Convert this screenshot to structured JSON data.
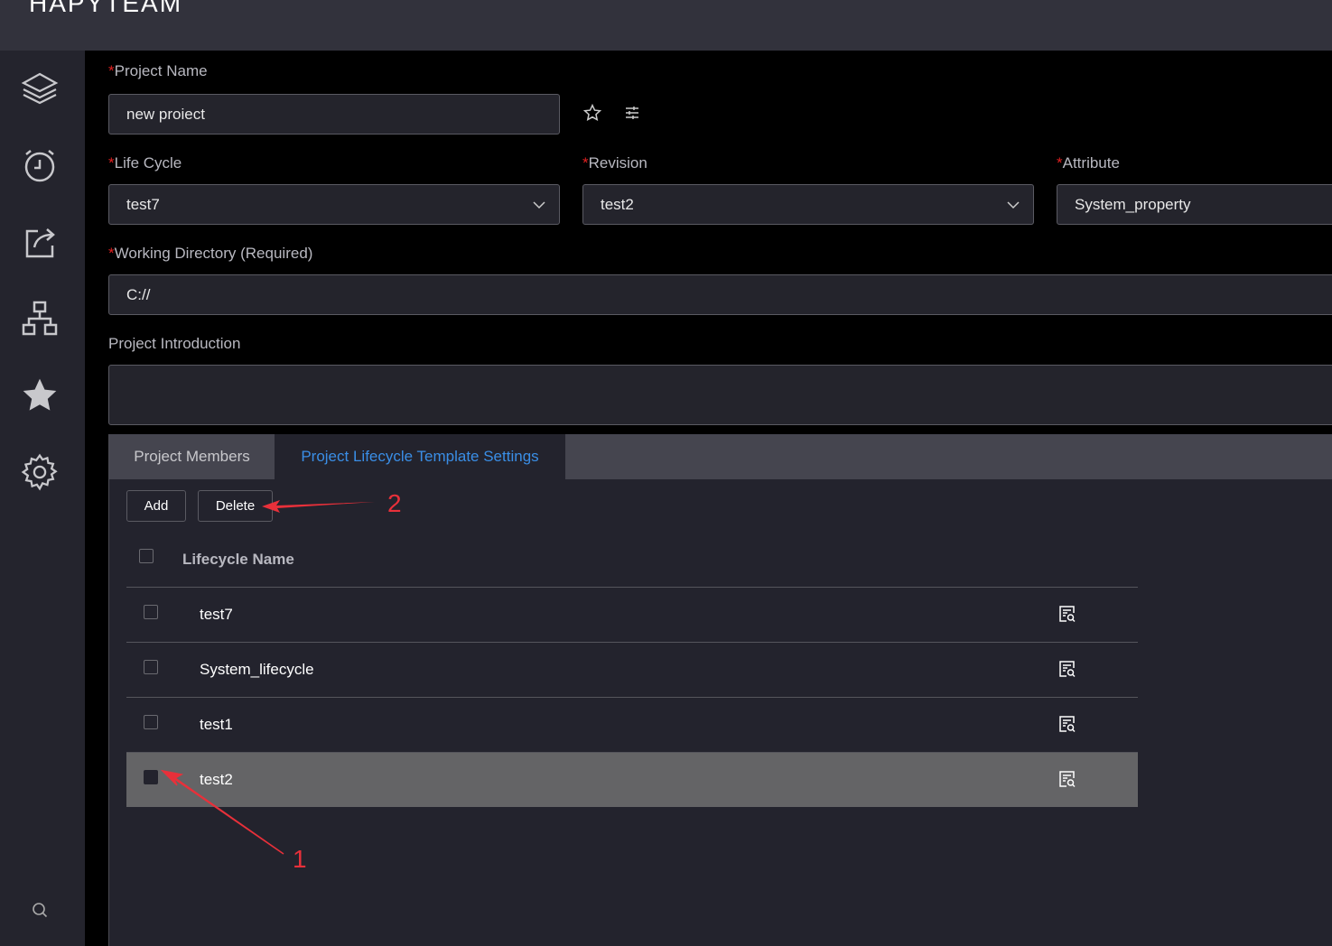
{
  "app": {
    "title": "HAPYTEAM"
  },
  "sidebar": {
    "items": [
      {
        "icon": "layers-icon"
      },
      {
        "icon": "alarm-clock-icon"
      },
      {
        "icon": "share-icon"
      },
      {
        "icon": "hierarchy-icon"
      },
      {
        "icon": "star-icon"
      },
      {
        "icon": "gear-icon"
      },
      {
        "icon": "search-icon"
      }
    ]
  },
  "form": {
    "project_name": {
      "label": "Project Name",
      "required": "*",
      "value": "new proiect"
    },
    "life_cycle": {
      "label": "Life Cycle",
      "required": "*",
      "value": "test7"
    },
    "revision": {
      "label": "Revision",
      "required": "*",
      "value": "test2"
    },
    "attribute": {
      "label": "Attribute",
      "required": "*",
      "value": "System_property"
    },
    "working_directory": {
      "label": "Working Directory (Required)",
      "required": "*",
      "value": "C://"
    },
    "introduction": {
      "label": "Project Introduction",
      "value": ""
    }
  },
  "tabs": [
    {
      "label": "Project Members",
      "active": false
    },
    {
      "label": "Project Lifecycle Template Settings",
      "active": true
    }
  ],
  "toolbar": {
    "add": "Add",
    "delete": "Delete"
  },
  "table": {
    "header": "Lifecycle Name",
    "rows": [
      {
        "name": "test7",
        "selected": false
      },
      {
        "name": "System_lifecycle",
        "selected": false
      },
      {
        "name": "test1",
        "selected": false
      },
      {
        "name": "test2",
        "selected": true
      }
    ]
  },
  "annotations": {
    "one": "1",
    "two": "2",
    "color": "#e8303a"
  },
  "colors": {
    "accent": "#3a8ee6",
    "required": "#e02020"
  }
}
